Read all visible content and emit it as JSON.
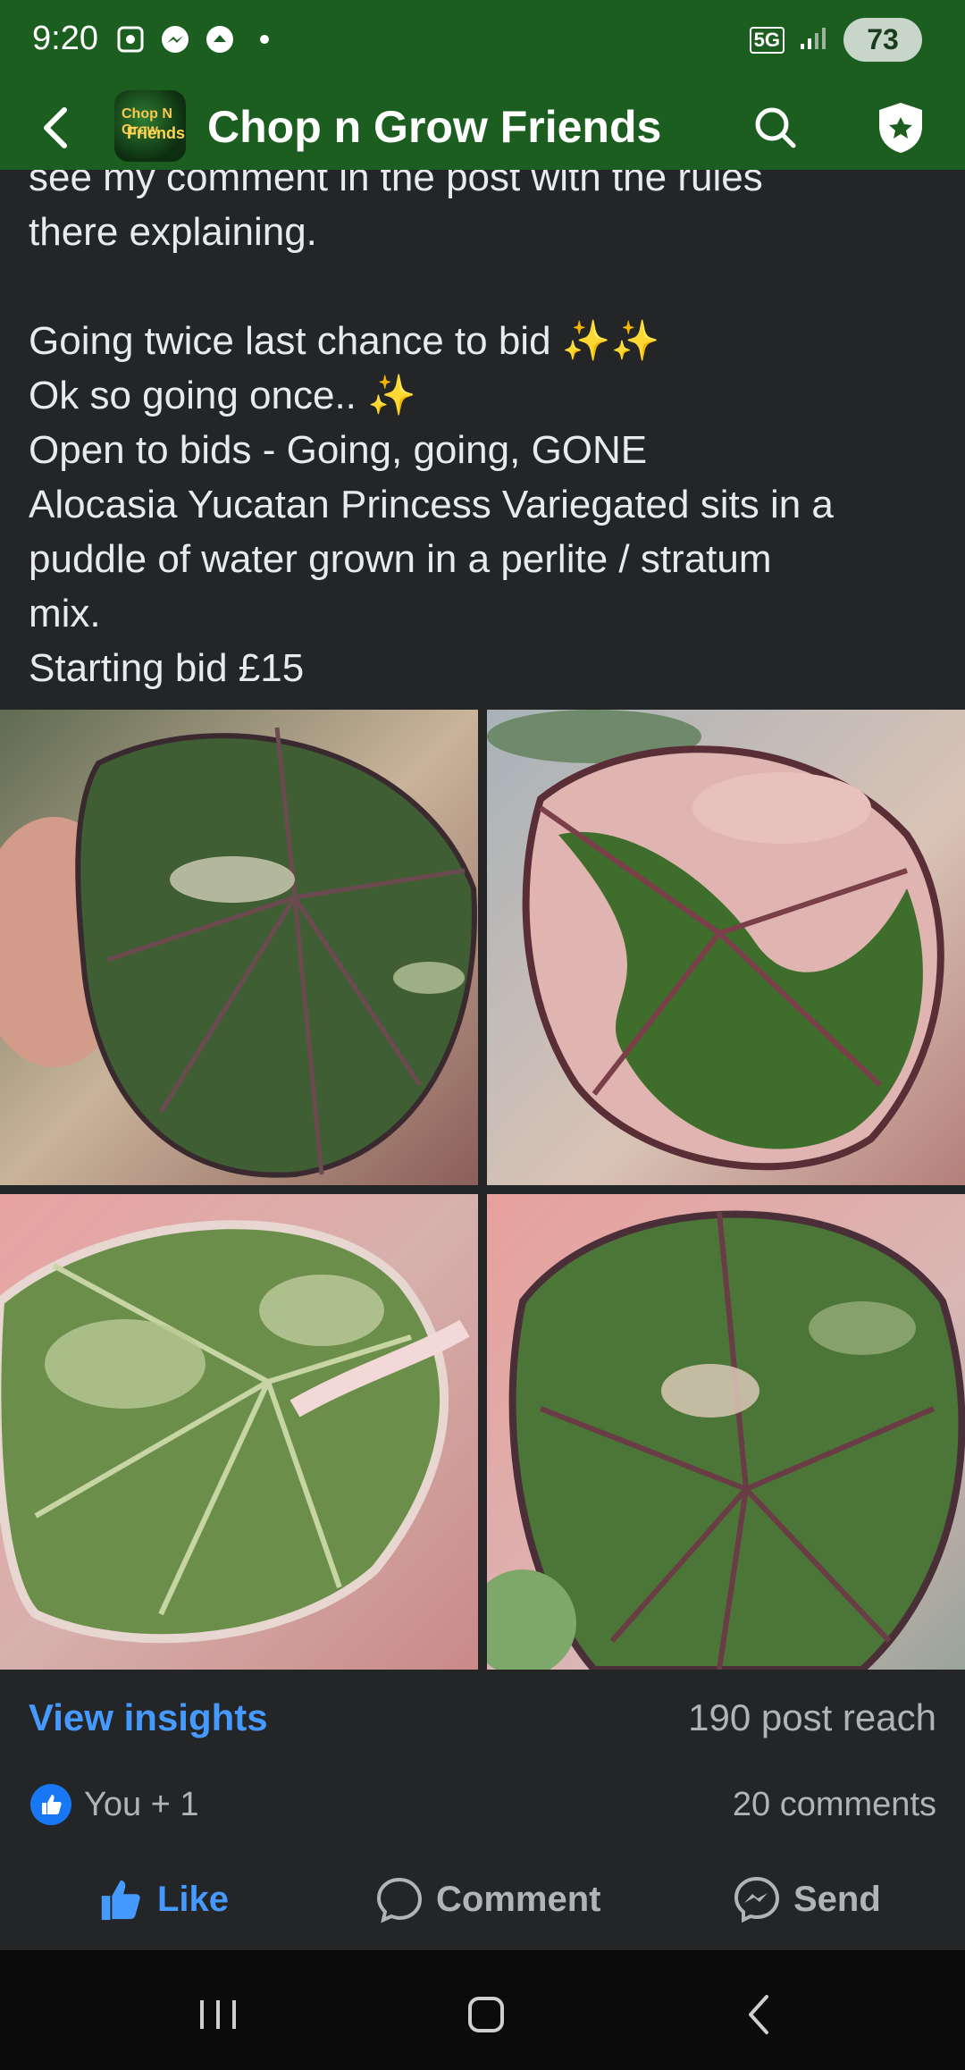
{
  "status_bar": {
    "time": "9:20",
    "network": "5G",
    "battery": "73"
  },
  "app_bar": {
    "title": "Chop n Grow Friends",
    "logo_text_1": "Chop N Grow",
    "logo_text_2": "Friends"
  },
  "post": {
    "text": "see my comment in the post with the rules\nthere explaining.\n\nGoing twice last chance to bid ✨✨\nOk so going once..  ✨\nOpen to bids - Going, going, GONE\nAlocasia Yucatan Princess Variegated sits in a\npuddle of water grown in a perlite / stratum\nmix.\nStarting bid £15"
  },
  "stats": {
    "insights_label": "View insights",
    "reach": "190 post reach",
    "reaction_text": "You + 1",
    "comments": "20 comments"
  },
  "actions": {
    "like": "Like",
    "comment": "Comment",
    "send": "Send"
  },
  "colors": {
    "header_green": "#1b5e20",
    "link_blue": "#4599ff",
    "bg": "#242526"
  }
}
